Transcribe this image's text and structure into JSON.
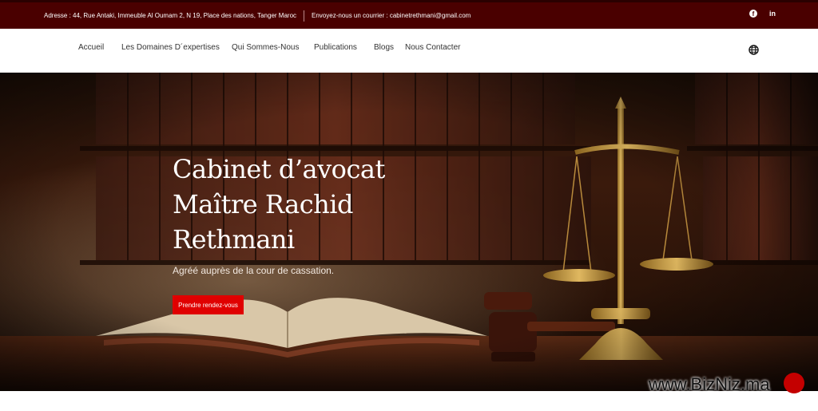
{
  "topbar": {
    "address": "Adresse : 44, Rue Antaki, Immeuble Al Oumam 2, N 19, Place des nations, Tanger Maroc",
    "email": "Envoyez-nous un courrier : cabinetrethmani@gmail.com",
    "social": [
      "facebook-icon",
      "linkedin-icon"
    ],
    "background": "#4a0000"
  },
  "nav": {
    "items": [
      "Accueil",
      "Les Domaines D´expertises",
      "Qui Sommes-Nous",
      "Publications",
      "Blogs",
      "Nous Contacter"
    ],
    "language_icon": "globe-icon"
  },
  "hero": {
    "title_lines": [
      "Cabinet d’avocat",
      "Maître Rachid",
      "Rethmani"
    ],
    "subtitle": "Agréé auprès de la cour de cassation.",
    "cta_label": "Prendre rendez-vous",
    "cta_color": "#e00000"
  },
  "watermark": "www.BizNiz.ma"
}
